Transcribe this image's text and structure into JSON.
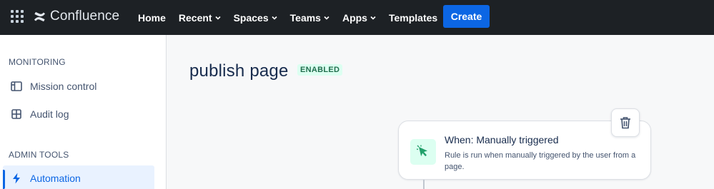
{
  "topnav": {
    "app_name": "Confluence",
    "items": [
      {
        "label": "Home",
        "dropdown": false
      },
      {
        "label": "Recent",
        "dropdown": true
      },
      {
        "label": "Spaces",
        "dropdown": true
      },
      {
        "label": "Teams",
        "dropdown": true
      },
      {
        "label": "Apps",
        "dropdown": true
      },
      {
        "label": "Templates",
        "dropdown": false
      }
    ],
    "create_label": "Create"
  },
  "sidebar": {
    "monitoring_title": "MONITORING",
    "monitoring_items": [
      {
        "label": "Mission control",
        "icon": "panel-layout-icon"
      },
      {
        "label": "Audit log",
        "icon": "grid-table-icon"
      }
    ],
    "admin_title": "ADMIN TOOLS",
    "admin_items": [
      {
        "label": "Automation",
        "icon": "lightning-bolt-icon",
        "active": true
      }
    ]
  },
  "main": {
    "title": "publish page",
    "status_badge": "ENABLED",
    "trigger": {
      "title": "When: Manually triggered",
      "description": "Rule is run when manually triggered by the user from a page.",
      "icon": "cursor-click-icon"
    }
  },
  "colors": {
    "nav_bg": "#1d2125",
    "create_button": "#0c66e4",
    "active_bg": "#e9f2ff",
    "active_text": "#0c66e4",
    "badge_bg": "#dcfff1",
    "badge_text": "#216e4e",
    "trigger_icon": "#22a06b"
  }
}
